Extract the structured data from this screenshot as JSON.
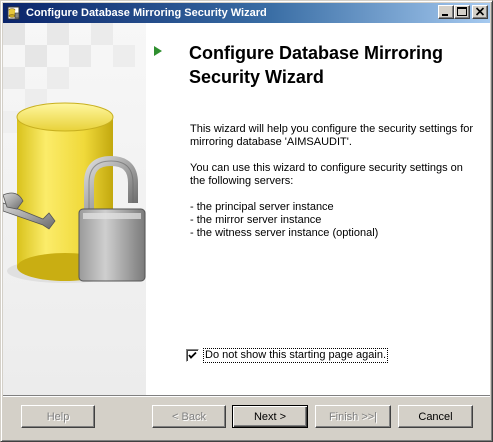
{
  "window": {
    "title": "Configure Database Mirroring Security Wizard",
    "controls": {
      "minimize": "minimize",
      "maximize": "maximize",
      "close": "close"
    }
  },
  "page": {
    "heading": "Configure Database Mirroring Security Wizard",
    "intro": "This wizard will help you configure the security settings for mirroring database 'AIMSAUDIT'.",
    "servers_intro": "You can use this wizard to configure security settings on the following servers:",
    "servers": [
      "- the principal server instance",
      "- the mirror server instance",
      "- the witness server instance (optional)"
    ],
    "dont_show_label": "Do not show this starting page again.",
    "dont_show_checked": true
  },
  "buttons": {
    "help": "Help",
    "back": "< Back",
    "next": "Next >",
    "finish": "Finish >>|",
    "cancel": "Cancel"
  },
  "icons": {
    "title": "database-window-icon",
    "art": "database-lock-wrench-art",
    "arrow": "green-arrow-icon"
  },
  "colors": {
    "title_gradient_start": "#0a246a",
    "title_gradient_end": "#a6caf0",
    "arrow_green": "#2f8f2f",
    "database_yellow": "#e8d23a"
  }
}
